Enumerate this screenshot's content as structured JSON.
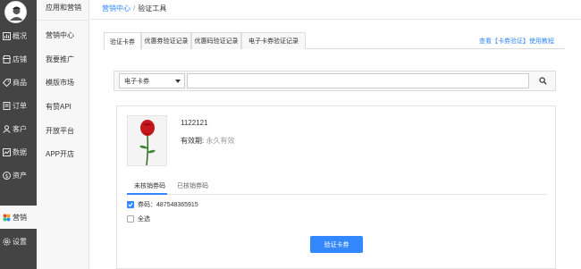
{
  "sidebar": {
    "items": [
      {
        "label": "概况",
        "icon": "overview-icon"
      },
      {
        "label": "店铺",
        "icon": "store-icon"
      },
      {
        "label": "商品",
        "icon": "tag-icon"
      },
      {
        "label": "订单",
        "icon": "order-icon"
      },
      {
        "label": "客户",
        "icon": "user-icon"
      },
      {
        "label": "数据",
        "icon": "chart-icon"
      },
      {
        "label": "资产",
        "icon": "money-icon"
      },
      {
        "label": "营销",
        "icon": "marketing-icon"
      },
      {
        "label": "设置",
        "icon": "gear-icon"
      }
    ]
  },
  "subsidebar": {
    "title": "应用和营销",
    "items": [
      "营销中心",
      "我要推广",
      "模版市场",
      "有赞API",
      "开放平台",
      "APP开店"
    ]
  },
  "breadcrumb": {
    "root": "营销中心",
    "separator": "/",
    "current": "验证工具"
  },
  "tabs": [
    "验证卡券",
    "优惠券验证记录",
    "优惠码验证记录",
    "电子卡券验证记录"
  ],
  "help_link": "查看【卡券验证】使用教程",
  "search": {
    "type_value": "电子卡券",
    "input_value": ""
  },
  "coupon": {
    "name": "1122121",
    "validity_label": "有效期:",
    "validity_value": "永久有效"
  },
  "subtabs": [
    "未核销券码",
    "已核销券码"
  ],
  "codes": [
    {
      "label": "券码：487548365915",
      "checked": true
    }
  ],
  "select_all": "全选",
  "verify_button": "验证卡券",
  "colors": {
    "accent": "#3388ff",
    "sidebar_bg": "#444444"
  }
}
